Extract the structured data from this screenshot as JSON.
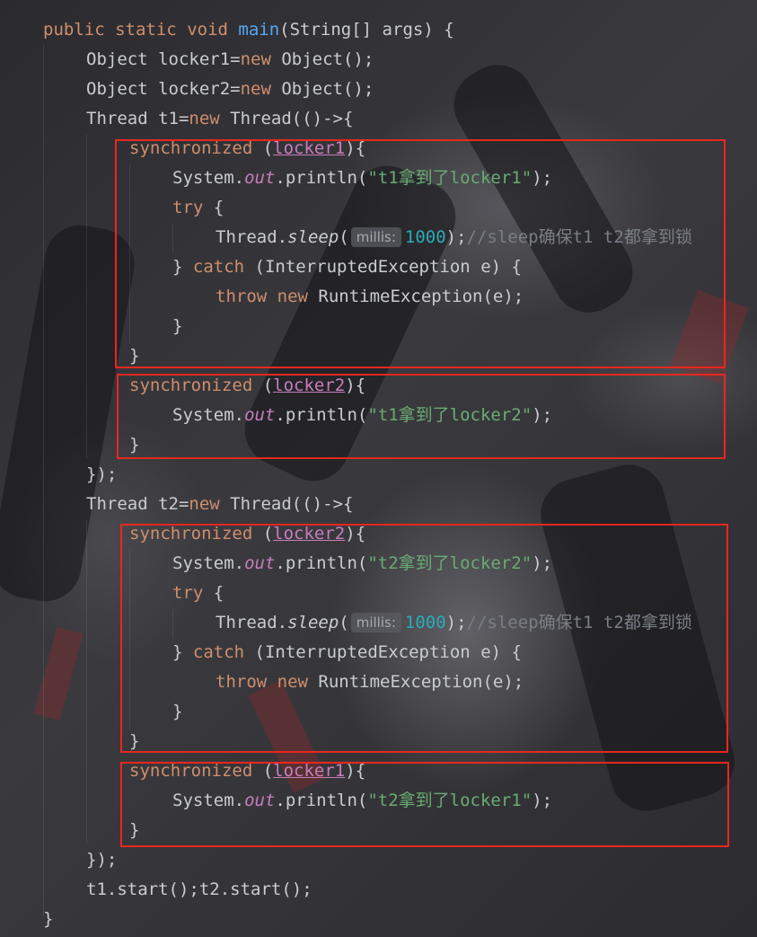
{
  "code": {
    "main_sig": {
      "k1": "public",
      "k2": "static",
      "k3": "void",
      "name": "main",
      "rest": "(String[] args) {"
    },
    "l2": {
      "t1": "Object locker1=",
      "kw": "new",
      "t2": " Object();"
    },
    "l3": {
      "t1": "Object locker2=",
      "kw": "new",
      "t2": " Object();"
    },
    "l4": {
      "t1": "Thread t1=",
      "kw": "new",
      "t2": " Thread(()->{"
    },
    "t1_sync1": {
      "kw": "synchronized",
      "open": " (",
      "var": "locker1",
      "close": "){"
    },
    "t1_print1": {
      "a": "System.",
      "field": "out",
      "b": ".println(",
      "str": "\"t1拿到了locker1\"",
      "c": ");"
    },
    "try_kw": "try",
    "brace_open": " {",
    "sleep": {
      "a": "Thread.",
      "m": "sleep",
      "p": "(",
      "hint": "millis:",
      "num": "1000",
      "c": ");",
      "cmt": "//sleep确保t1 t2都拿到锁"
    },
    "catch": {
      "a": "} ",
      "kw": "catch",
      "b": " (InterruptedException e) {"
    },
    "throw": {
      "k1": "throw",
      "k2": "new",
      "b": " RuntimeException(e);"
    },
    "close_brace": "}",
    "t1_sync2": {
      "kw": "synchronized",
      "open": " (",
      "var": "locker2",
      "close": "){"
    },
    "t1_print2": {
      "a": "System.",
      "field": "out",
      "b": ".println(",
      "str": "\"t1拿到了locker2\"",
      "c": ");"
    },
    "end_lambda": "});",
    "l_t2": {
      "t1": "Thread t2=",
      "kw": "new",
      "t2": " Thread(()->{"
    },
    "t2_sync1": {
      "kw": "synchronized",
      "open": " (",
      "var": "locker2",
      "close": "){"
    },
    "t2_print1": {
      "a": "System.",
      "field": "out",
      "b": ".println(",
      "str": "\"t2拿到了locker2\"",
      "c": ");"
    },
    "t2_sync2": {
      "kw": "synchronized",
      "open": " (",
      "var": "locker1",
      "close": "){"
    },
    "t2_print2": {
      "a": "System.",
      "field": "out",
      "b": ".println(",
      "str": "\"t2拿到了locker1\"",
      "c": ");"
    },
    "start": "t1.start();t2.start();"
  },
  "colors": {
    "highlight_box": "#e8271f",
    "keyword": "#cf8e6d",
    "string": "#6aab73",
    "method": "#56a8f5",
    "number": "#2aacb8"
  }
}
